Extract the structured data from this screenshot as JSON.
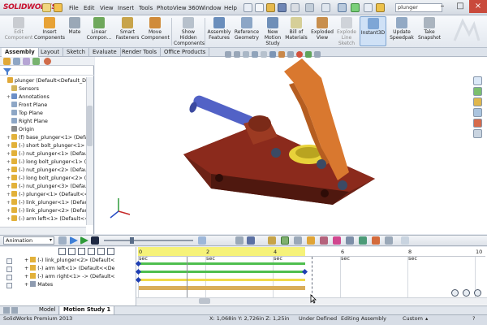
{
  "app": {
    "brand": "SOLIDWORKS",
    "menu": [
      "File",
      "Edit",
      "View",
      "Insert",
      "Tools",
      "PhotoView 360",
      "Window",
      "Help"
    ],
    "search_value": "plunger",
    "window_controls": [
      "–",
      "□",
      "×"
    ]
  },
  "ribbon": {
    "buttons": [
      {
        "label": "Edit Component",
        "disabled": true
      },
      {
        "label": "Insert Components"
      },
      {
        "label": "Mate"
      },
      {
        "label": "Linear Compon..."
      },
      {
        "label": "Smart Fasteners"
      },
      {
        "label": "Move Component"
      },
      {
        "label": "Show Hidden Components"
      },
      {
        "label": "Assembly Features"
      },
      {
        "label": "Reference Geometry"
      },
      {
        "label": "New Motion Study"
      },
      {
        "label": "Bill of Materials"
      },
      {
        "label": "Exploded View"
      },
      {
        "label": "Explode Line Sketch"
      },
      {
        "label": "Instant3D",
        "active": true
      },
      {
        "label": "Update Speedpak"
      },
      {
        "label": "Take Snapshot"
      }
    ]
  },
  "cmd_tabs": [
    "Assembly",
    "Layout",
    "Sketch",
    "Evaluate",
    "Render Tools",
    "Office Products"
  ],
  "feature_tree": [
    {
      "label": "plunger (Default<Default_Disp",
      "level": 0,
      "icon": "assembly-icon"
    },
    {
      "label": "Sensors",
      "level": 1,
      "icon": "sensor-icon"
    },
    {
      "label": "Annotations",
      "level": 1,
      "icon": "annotation-icon",
      "expand": "+"
    },
    {
      "label": "Front Plane",
      "level": 1,
      "icon": "plane-icon"
    },
    {
      "label": "Top Plane",
      "level": 1,
      "icon": "plane-icon"
    },
    {
      "label": "Right Plane",
      "level": 1,
      "icon": "plane-icon"
    },
    {
      "label": "Origin",
      "level": 1,
      "icon": "origin-icon"
    },
    {
      "label": "(f) base_plunger<1> (Defau",
      "level": 1,
      "icon": "part-icon",
      "expand": "+"
    },
    {
      "label": "(-) short bolt_plunger<1> (",
      "level": 1,
      "icon": "part-icon",
      "expand": "+"
    },
    {
      "label": "(-) nut_plunger<1> (Defaul",
      "level": 1,
      "icon": "part-icon",
      "expand": "+"
    },
    {
      "label": "(-) long bolt_plunger<1> (I",
      "level": 1,
      "icon": "part-icon",
      "expand": "+"
    },
    {
      "label": "(-) nut_plunger<2> (Defaul",
      "level": 1,
      "icon": "part-icon",
      "expand": "+"
    },
    {
      "label": "(-) long bolt_plunger<2> (I",
      "level": 1,
      "icon": "part-icon",
      "expand": "+"
    },
    {
      "label": "(-) nut_plunger<3> (Defaul",
      "level": 1,
      "icon": "part-icon",
      "expand": "+"
    },
    {
      "label": "(-) plunger<1> (Default<<",
      "level": 1,
      "icon": "part-icon",
      "expand": "+"
    },
    {
      "label": "(-) link_plunger<1> (Defau",
      "level": 1,
      "icon": "part-icon",
      "expand": "+"
    },
    {
      "label": "(-) link_plunger<2> (Defau",
      "level": 1,
      "icon": "part-icon",
      "expand": "+"
    },
    {
      "label": "(-) arm left<1> (Default<<",
      "level": 1,
      "icon": "part-icon",
      "expand": "+"
    }
  ],
  "motion": {
    "study_type": "Animation",
    "tree": [
      {
        "label": "(-) link_plunger<2> (Default<",
        "icon": "part-icon"
      },
      {
        "label": "(-) arm left<1> (Default<<De",
        "icon": "part-icon"
      },
      {
        "label": "(-) arm right<1> -> (Default<",
        "icon": "part-icon"
      },
      {
        "label": "Mates",
        "icon": "mates-icon"
      }
    ],
    "time_ticks": [
      "0 sec",
      "2 sec",
      "4 sec",
      "6 sec",
      "8 sec",
      "10"
    ],
    "time_ticks_extent_sec": 10
  },
  "bottom_tabs": [
    "Model",
    "Motion Study 1"
  ],
  "status": {
    "product": "SolidWorks Premium 2013",
    "coords": "X: 1,068in Y: 2,726in Z: 1,25in",
    "state": "Under Defined",
    "mode": "Editing Assembly",
    "units": "Custom"
  },
  "colors": {
    "body_red": "#8b2a1c",
    "arm_orange": "#d9782f",
    "bracket_yellow": "#e8d23a",
    "plunger_blue": "#5262c6",
    "timeline_yellow": "#f6f279",
    "keyframe_blue": "#1f3fb3"
  }
}
